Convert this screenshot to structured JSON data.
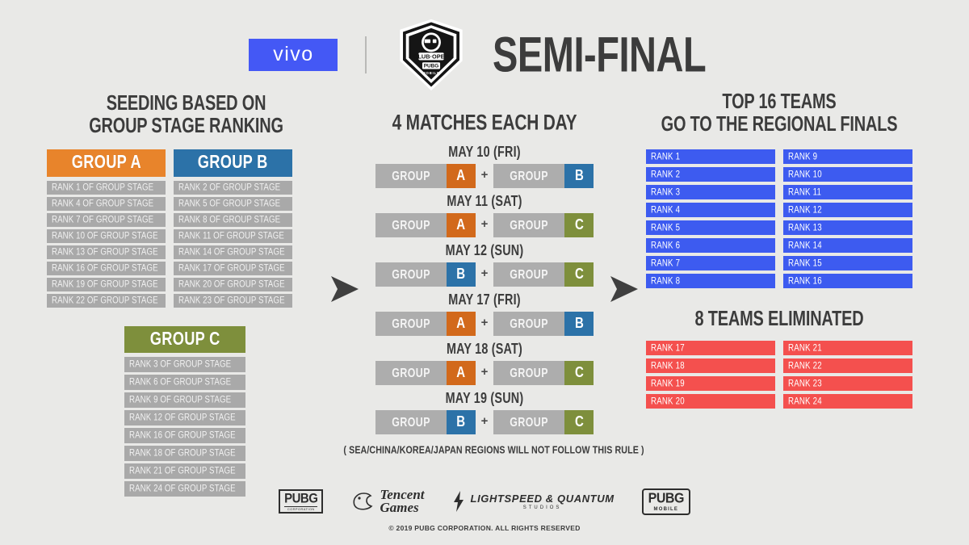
{
  "header": {
    "sponsor_logo": "vivo",
    "event_logo_alt": "CLUB OPEN PUBG MOBILE",
    "title": "SEMI-FINAL"
  },
  "seeding": {
    "title_line1": "SEEDING BASED ON",
    "title_line2": "GROUP STAGE RANKING",
    "groups": [
      {
        "name": "GROUP A",
        "color": "#e8842b",
        "rows": [
          "RANK 1 OF GROUP STAGE",
          "RANK 4 OF GROUP STAGE",
          "RANK 7 OF GROUP STAGE",
          "RANK 10 OF GROUP STAGE",
          "RANK 13 OF GROUP STAGE",
          "RANK 16 OF GROUP STAGE",
          "RANK 19 OF GROUP STAGE",
          "RANK 22 OF GROUP STAGE"
        ]
      },
      {
        "name": "GROUP B",
        "color": "#2c72a8",
        "rows": [
          "RANK 2 OF GROUP STAGE",
          "RANK 5 OF GROUP STAGE",
          "RANK 8 OF GROUP STAGE",
          "RANK 11 OF GROUP STAGE",
          "RANK 14 OF GROUP STAGE",
          "RANK 17 OF GROUP STAGE",
          "RANK 20 OF GROUP STAGE",
          "RANK 23 OF GROUP STAGE"
        ]
      },
      {
        "name": "GROUP C",
        "color": "#7e8f3c",
        "rows": [
          "RANK 3 OF GROUP STAGE",
          "RANK 6 OF GROUP STAGE",
          "RANK 9 OF GROUP STAGE",
          "RANK 12 OF GROUP STAGE",
          "RANK 16 OF GROUP STAGE",
          "RANK 18 OF GROUP STAGE",
          "RANK 21 OF GROUP STAGE",
          "RANK 24 OF GROUP STAGE"
        ]
      }
    ]
  },
  "schedule": {
    "title": "4 MATCHES EACH DAY",
    "group_word": "GROUP",
    "plus": "+",
    "footnote": "( SEA/CHINA/KOREA/JAPAN REGIONS WILL NOT FOLLOW THIS RULE )",
    "days": [
      {
        "date": "MAY 10 (FRI)",
        "left": "A",
        "left_color": "#d2691b",
        "right": "B",
        "right_color": "#2c72a8"
      },
      {
        "date": "MAY 11 (SAT)",
        "left": "A",
        "left_color": "#d2691b",
        "right": "C",
        "right_color": "#7e8f3c"
      },
      {
        "date": "MAY 12 (SUN)",
        "left": "B",
        "left_color": "#2c72a8",
        "right": "C",
        "right_color": "#7e8f3c"
      },
      {
        "date": "MAY 17 (FRI)",
        "left": "A",
        "left_color": "#d2691b",
        "right": "B",
        "right_color": "#2c72a8"
      },
      {
        "date": "MAY 18 (SAT)",
        "left": "A",
        "left_color": "#d2691b",
        "right": "C",
        "right_color": "#7e8f3c"
      },
      {
        "date": "MAY 19 (SUN)",
        "left": "B",
        "left_color": "#2c72a8",
        "right": "C",
        "right_color": "#7e8f3c"
      }
    ]
  },
  "results": {
    "qualified_title_line1": "TOP 16 TEAMS",
    "qualified_title_line2": "GO TO THE REGIONAL FINALS",
    "qualified_color": "#3d5bf0",
    "qualified_left": [
      "RANK 1",
      "RANK 2",
      "RANK 3",
      "RANK 4",
      "RANK 5",
      "RANK 6",
      "RANK 7",
      "RANK 8"
    ],
    "qualified_right": [
      "RANK 9",
      "RANK 10",
      "RANK 11",
      "RANK 12",
      "RANK 13",
      "RANK 14",
      "RANK 15",
      "RANK 16"
    ],
    "eliminated_title": "8 TEAMS ELIMINATED",
    "eliminated_color": "#f4504e",
    "eliminated_left": [
      "RANK 17",
      "RANK 18",
      "RANK 19",
      "RANK 20"
    ],
    "eliminated_right": [
      "RANK 21",
      "RANK 22",
      "RANK 23",
      "RANK 24"
    ]
  },
  "footer": {
    "pubg_corp_big": "PUBG",
    "pubg_corp_small": "CORPORATION",
    "tencent_line1": "Tencent",
    "tencent_line2": "Games",
    "lsq_main": "LIGHTSPEED & QUANTUM",
    "lsq_sub": "STUDIOS",
    "pubgm_big": "PUBG",
    "pubgm_small": "MOBILE",
    "copyright": "© 2019 PUBG CORPORATION. ALL RIGHTS RESERVED"
  }
}
